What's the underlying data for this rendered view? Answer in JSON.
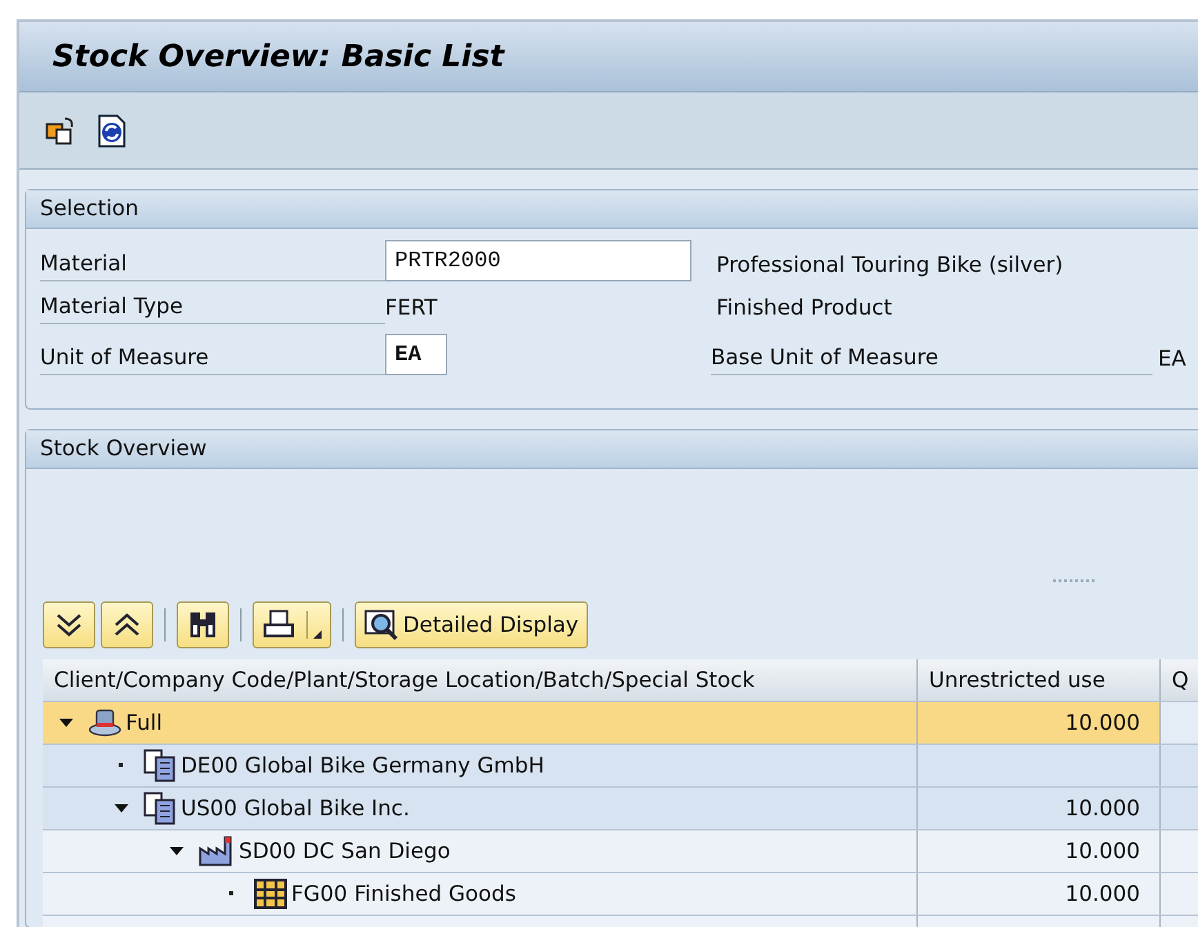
{
  "window": {
    "title": "Stock Overview: Basic List"
  },
  "selection": {
    "title": "Selection",
    "rows": [
      {
        "kind": "input",
        "label": "Material",
        "value": "PRTR2000",
        "description": "Professional Touring Bike (silver)"
      },
      {
        "kind": "text",
        "label": "Material Type",
        "value": "FERT",
        "description": "Finished Product"
      },
      {
        "kind": "input_pair",
        "label": "Unit of Measure",
        "value": "EA",
        "second_label": "Base Unit of Measure",
        "second_value": "EA"
      }
    ]
  },
  "stock_overview": {
    "title": "Stock Overview",
    "buttons": [
      {
        "kind": "expand"
      },
      {
        "kind": "collapse"
      },
      {
        "kind": "find"
      },
      {
        "kind": "print"
      },
      {
        "kind": "detail",
        "label": "Detailed Display"
      }
    ],
    "table": {
      "columns": [
        "Client/Company Code/Plant/Storage Location/Batch/Special Stock",
        "Unrestricted use",
        "Q"
      ],
      "rows": [
        {
          "kind": "client",
          "label": "Full",
          "quantity": "10.000",
          "selected": true,
          "expanded": true,
          "children": [
            {
              "kind": "company",
              "label": "DE00 Global Bike Germany GmbH",
              "selected": false
            },
            {
              "kind": "company",
              "label": "US00 Global Bike Inc.",
              "quantity": "10.000",
              "selected": false,
              "expanded": true,
              "children": [
                {
                  "kind": "plant",
                  "label": "SD00 DC San Diego",
                  "quantity": "10.000",
                  "selected": false,
                  "expanded": true,
                  "children": [
                    {
                      "kind": "storage",
                      "label": "FG00 Finished Goods",
                      "quantity": "10.000",
                      "selected": false
                    }
                  ]
                }
              ]
            }
          ]
        }
      ]
    }
  }
}
